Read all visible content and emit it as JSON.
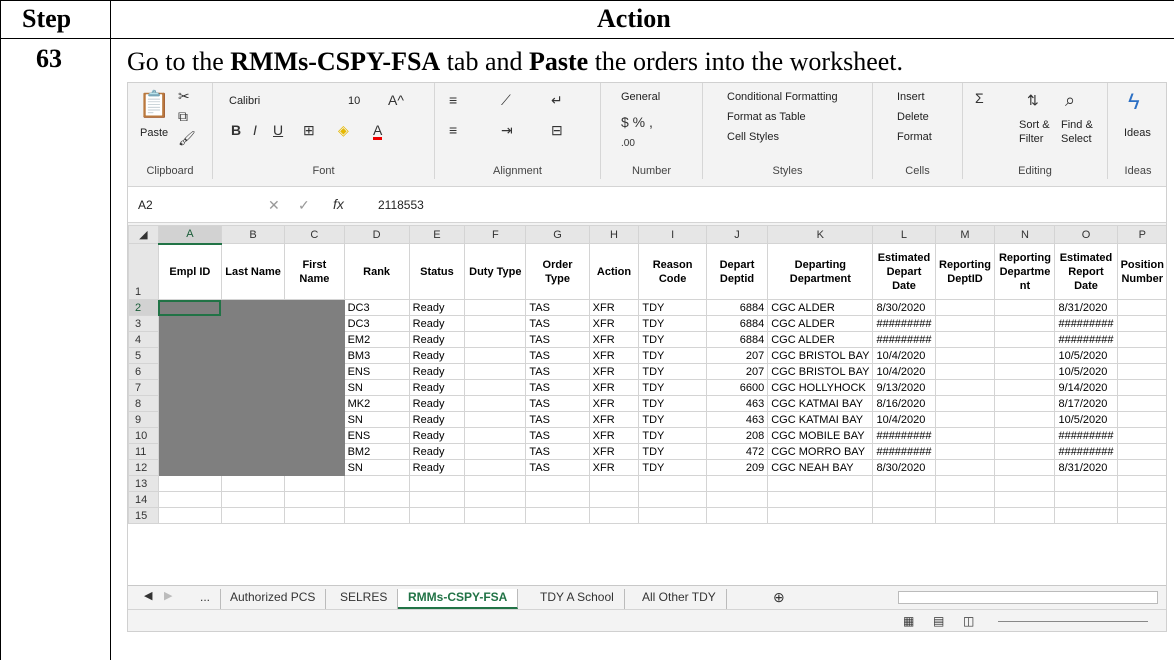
{
  "table_header": {
    "step": "Step",
    "action": "Action"
  },
  "step": {
    "number": "63",
    "instruction_pre": "Go to the ",
    "tab_name": "RMMs-CSPY-FSA",
    "instruction_mid": " tab and ",
    "paste_word": "Paste",
    "instruction_post": " the orders into the worksheet."
  },
  "ribbon": {
    "clipboard": {
      "paste": "Paste",
      "label": "Clipboard"
    },
    "font": {
      "name": "Calibri",
      "size": "10",
      "label": "Font"
    },
    "alignment": {
      "label": "Alignment"
    },
    "number": {
      "format": "General",
      "label": "Number"
    },
    "styles": {
      "conditional": "Conditional Formatting",
      "table": "Format as Table",
      "cell": "Cell Styles",
      "label": "Styles"
    },
    "cells": {
      "insert": "Insert",
      "delete": "Delete",
      "format": "Format",
      "label": "Cells"
    },
    "editing": {
      "sort": "Sort &",
      "filter": "Filter",
      "find": "Find &",
      "select": "Select",
      "label": "Editing"
    },
    "ideas": {
      "btn": "Ideas",
      "label": "Ideas"
    }
  },
  "formula_bar": {
    "cell": "A2",
    "value": "2118553"
  },
  "columns": [
    "A",
    "B",
    "C",
    "D",
    "E",
    "F",
    "G",
    "H",
    "I",
    "J",
    "K",
    "L",
    "M",
    "N",
    "O",
    "P"
  ],
  "headers": [
    "Empl ID",
    "Last Name",
    "First Name",
    "Rank",
    "Status",
    "Duty Type",
    "Order Type",
    "Action",
    "Reason Code",
    "Depart Deptid",
    "Departing Department",
    "Estimated Depart Date",
    "Reporting DeptID",
    "Reporting Departme nt",
    "Estimated Report Date",
    "Position Number"
  ],
  "rows": [
    {
      "n": "2",
      "rank": "DC3",
      "status": "Ready",
      "order": "TAS",
      "action": "XFR",
      "reason": "TDY",
      "deptid": "6884",
      "dept": "CGC ALDER",
      "edate": "8/30/2020",
      "rdate": "8/31/2020"
    },
    {
      "n": "3",
      "rank": "DC3",
      "status": "Ready",
      "order": "TAS",
      "action": "XFR",
      "reason": "TDY",
      "deptid": "6884",
      "dept": "CGC ALDER",
      "edate": "#########",
      "rdate": "#########"
    },
    {
      "n": "4",
      "rank": "EM2",
      "status": "Ready",
      "order": "TAS",
      "action": "XFR",
      "reason": "TDY",
      "deptid": "6884",
      "dept": "CGC ALDER",
      "edate": "#########",
      "rdate": "#########"
    },
    {
      "n": "5",
      "rank": "BM3",
      "status": "Ready",
      "order": "TAS",
      "action": "XFR",
      "reason": "TDY",
      "deptid": "207",
      "dept": "CGC BRISTOL BAY",
      "edate": "10/4/2020",
      "rdate": "10/5/2020"
    },
    {
      "n": "6",
      "rank": "ENS",
      "status": "Ready",
      "order": "TAS",
      "action": "XFR",
      "reason": "TDY",
      "deptid": "207",
      "dept": "CGC BRISTOL BAY",
      "edate": "10/4/2020",
      "rdate": "10/5/2020"
    },
    {
      "n": "7",
      "rank": "SN",
      "status": "Ready",
      "order": "TAS",
      "action": "XFR",
      "reason": "TDY",
      "deptid": "6600",
      "dept": "CGC HOLLYHOCK",
      "edate": "9/13/2020",
      "rdate": "9/14/2020"
    },
    {
      "n": "8",
      "rank": "MK2",
      "status": "Ready",
      "order": "TAS",
      "action": "XFR",
      "reason": "TDY",
      "deptid": "463",
      "dept": "CGC KATMAI BAY",
      "edate": "8/16/2020",
      "rdate": "8/17/2020"
    },
    {
      "n": "9",
      "rank": "SN",
      "status": "Ready",
      "order": "TAS",
      "action": "XFR",
      "reason": "TDY",
      "deptid": "463",
      "dept": "CGC KATMAI BAY",
      "edate": "10/4/2020",
      "rdate": "10/5/2020"
    },
    {
      "n": "10",
      "rank": "ENS",
      "status": "Ready",
      "order": "TAS",
      "action": "XFR",
      "reason": "TDY",
      "deptid": "208",
      "dept": "CGC MOBILE BAY",
      "edate": "#########",
      "rdate": "#########"
    },
    {
      "n": "11",
      "rank": "BM2",
      "status": "Ready",
      "order": "TAS",
      "action": "XFR",
      "reason": "TDY",
      "deptid": "472",
      "dept": "CGC MORRO BAY",
      "edate": "#########",
      "rdate": "#########"
    },
    {
      "n": "12",
      "rank": "SN",
      "status": "Ready",
      "order": "TAS",
      "action": "XFR",
      "reason": "TDY",
      "deptid": "209",
      "dept": "CGC NEAH BAY",
      "edate": "8/30/2020",
      "rdate": "8/31/2020"
    }
  ],
  "empty_rows": [
    "13",
    "14",
    "15"
  ],
  "sheet_tabs": {
    "more": "...",
    "t1": "Authorized PCS",
    "t2": "SELRES",
    "t3": "RMMs-CSPY-FSA",
    "t4": "TDY A School",
    "t5": "All Other TDY",
    "add": "⊕"
  },
  "accent": "#217346"
}
